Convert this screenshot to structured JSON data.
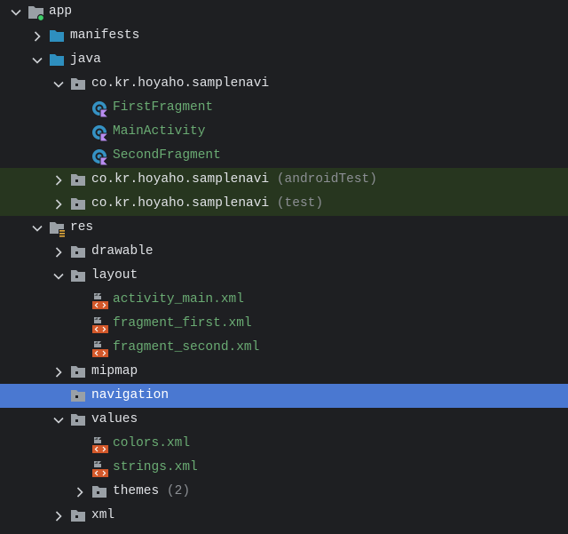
{
  "colors": {
    "background": "#1e1f22",
    "test_highlight": "#27361f",
    "selection": "#4a78d1",
    "text": "#dfe1e5",
    "file_text": "#6aab73",
    "hint_text": "#8c8f94",
    "module_folder": "#2e8fbf",
    "folder": "#9aa0a6",
    "xml_badge": "#d3582a",
    "kotlin_class": "#3592c4",
    "kotlin_badge": "#b88cf0",
    "module_dot": "#3fcf6a"
  },
  "rows": [
    {
      "label": "app",
      "level": 0,
      "arrow": "down",
      "icon": "module-folder-icon"
    },
    {
      "label": "manifests",
      "level": 1,
      "arrow": "right",
      "icon": "source-folder-icon"
    },
    {
      "label": "java",
      "level": 1,
      "arrow": "down",
      "icon": "source-folder-icon"
    },
    {
      "label": "co.kr.hoyaho.samplenavi",
      "level": 2,
      "arrow": "down",
      "icon": "package-icon"
    },
    {
      "label": "FirstFragment",
      "level": 3,
      "arrow": "none",
      "icon": "kotlin-class-icon",
      "style": "green"
    },
    {
      "label": "MainActivity",
      "level": 3,
      "arrow": "none",
      "icon": "kotlin-class-icon",
      "style": "green"
    },
    {
      "label": "SecondFragment",
      "level": 3,
      "arrow": "none",
      "icon": "kotlin-class-icon",
      "style": "green"
    },
    {
      "label": "co.kr.hoyaho.samplenavi",
      "hint": "(androidTest)",
      "level": 2,
      "arrow": "right",
      "icon": "package-icon",
      "highlight": true
    },
    {
      "label": "co.kr.hoyaho.samplenavi",
      "hint": "(test)",
      "level": 2,
      "arrow": "right",
      "icon": "package-icon",
      "highlight": true
    },
    {
      "label": "res",
      "level": 1,
      "arrow": "down",
      "icon": "resource-folder-icon"
    },
    {
      "label": "drawable",
      "level": 2,
      "arrow": "right",
      "icon": "package-icon"
    },
    {
      "label": "layout",
      "level": 2,
      "arrow": "down",
      "icon": "package-icon"
    },
    {
      "label": "activity_main.xml",
      "level": 3,
      "arrow": "none",
      "icon": "xml-file-icon",
      "style": "green"
    },
    {
      "label": "fragment_first.xml",
      "level": 3,
      "arrow": "none",
      "icon": "xml-file-icon",
      "style": "green"
    },
    {
      "label": "fragment_second.xml",
      "level": 3,
      "arrow": "none",
      "icon": "xml-file-icon",
      "style": "green"
    },
    {
      "label": "mipmap",
      "level": 2,
      "arrow": "right",
      "icon": "package-icon"
    },
    {
      "label": "navigation",
      "level": 2,
      "arrow": "none",
      "icon": "package-icon",
      "selected": true
    },
    {
      "label": "values",
      "level": 2,
      "arrow": "down",
      "icon": "package-icon"
    },
    {
      "label": "colors.xml",
      "level": 3,
      "arrow": "none",
      "icon": "xml-file-icon",
      "style": "green"
    },
    {
      "label": "strings.xml",
      "level": 3,
      "arrow": "none",
      "icon": "xml-file-icon",
      "style": "green"
    },
    {
      "label": "themes",
      "hint": "(2)",
      "level": 3,
      "arrow": "right",
      "icon": "package-icon"
    },
    {
      "label": "xml",
      "level": 2,
      "arrow": "right",
      "icon": "package-icon"
    }
  ]
}
